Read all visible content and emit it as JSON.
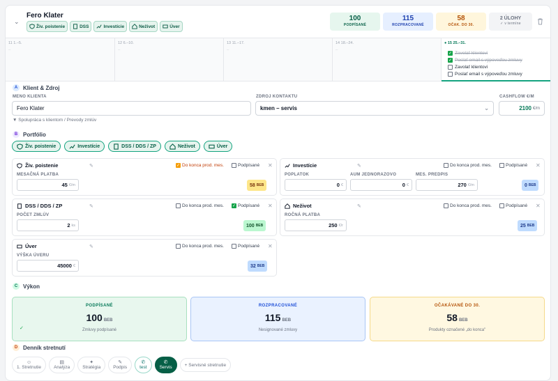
{
  "header": {
    "client_name": "Fero Klater",
    "chips": [
      "Živ. poistenie",
      "DSS",
      "Investície",
      "Neživot",
      "Úver"
    ],
    "kpis": [
      {
        "value": "100",
        "label": "PODPÍSANÉ",
        "color": "#e6f6ee"
      },
      {
        "value": "115",
        "label": "ROZPRACOVANÉ",
        "color": "#e6efff"
      },
      {
        "value": "58",
        "label": "OČAK. DO 30.",
        "color": "#fff6dc"
      },
      {
        "value": "2 ÚLOHY",
        "label": "✓ v termíne",
        "color": "#f3f4f6"
      }
    ]
  },
  "timeline": {
    "weeks": [
      {
        "title": "11  1.–5.",
        "dash": "–"
      },
      {
        "title": "12  6.–10.",
        "dash": "–"
      },
      {
        "title": "13  11.–17.",
        "dash": "–"
      },
      {
        "title": "14  18.–24.",
        "dash": "–"
      },
      {
        "title": "● 15  25.–31.",
        "dash": ""
      }
    ],
    "tasks": [
      {
        "text": "Zavolať klientovi",
        "done": true
      },
      {
        "text": "Poslať email s výpoveďou zmluvy",
        "done": true
      },
      {
        "text": "Zavolať klientovi",
        "done": false
      },
      {
        "text": "Poslať email s výpoveďou zmluvy",
        "done": false
      }
    ]
  },
  "client_section": {
    "badge": "A",
    "title": "Klient & Zdroj",
    "name_label": "MENO KLIENTA",
    "name_value": "Fero Klater",
    "source_label": "ZDROJ KONTAKTU",
    "source_value": "kmen – servis",
    "cashflow_label": "CASHFLOW €/M",
    "cashflow_value": "2100",
    "cashflow_unit": "€/m",
    "link": "▼ Spolupráca s klientom / Prevody zmlúv"
  },
  "portfolio": {
    "badge": "B",
    "title": "Portfólio",
    "chips": [
      "Živ. poistenie",
      "Investície",
      "DSS / DDS / ZP",
      "Neživot",
      "Úver"
    ],
    "opt_end": "Do konca prod. mes.",
    "opt_signed": "Podpísané",
    "beb": "BEB",
    "cards": {
      "ziv": {
        "title": "Živ. poistenie",
        "label": "MESAČNÁ PLATBA",
        "value": "45",
        "unit": "€/m",
        "beb": "58"
      },
      "inv": {
        "title": "Investície",
        "l1": "POPLATOK",
        "v1": "0",
        "l2": "AUM JEDNORAZOVO",
        "v2": "0",
        "l3": "MES. PREDPIS",
        "v3": "270",
        "u3": "€/m",
        "u": "€",
        "beb": "0"
      },
      "dss": {
        "title": "DSS / DDS / ZP",
        "label": "POČET ZMLÚV",
        "value": "2",
        "unit": "ks",
        "beb": "100"
      },
      "nez": {
        "title": "Neživot",
        "label": "ROČNÁ PLATBA",
        "value": "250",
        "unit": "€/r",
        "beb": "25"
      },
      "uver": {
        "title": "Úver",
        "label": "VÝŠKA ÚVERU",
        "value": "45000",
        "unit": "€",
        "beb": "32"
      }
    }
  },
  "vykon": {
    "badge": "C",
    "title": "Výkon",
    "boxes": [
      {
        "head": "PODPÍSANÉ",
        "value": "100",
        "unit": "BEB",
        "sub": "Zmluvy podpísané",
        "check": "✓"
      },
      {
        "head": "ROZPRACOVANÉ",
        "value": "115",
        "unit": "BEB",
        "sub": "Nesignované zmluvy"
      },
      {
        "head": "OČAKÁVANÉ DO 30.",
        "value": "58",
        "unit": "BEB",
        "sub": "Produkty označené „do konca\""
      }
    ]
  },
  "dennik": {
    "badge": "D",
    "title": "Denník stretnutí",
    "tabs": [
      "1. Stretnutie",
      "Analýza",
      "Stratégia",
      "Podpis",
      "test",
      "Servis"
    ],
    "add": "+ Servisné stretnutie"
  }
}
